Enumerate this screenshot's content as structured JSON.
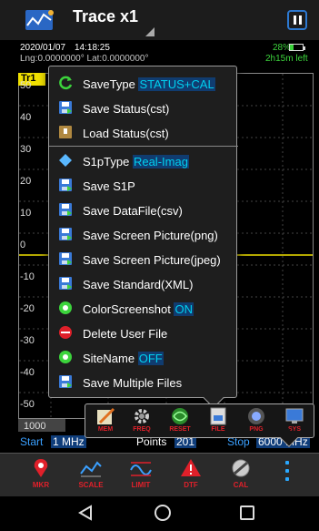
{
  "header": {
    "title": "Trace x1"
  },
  "status": {
    "date": "2020/01/07",
    "time": "14:18:25",
    "coords": "Lng:0.0000000° Lat:0.0000000°",
    "battery_pct": "28%",
    "battery_level": 0.28,
    "time_left": "2h15m left"
  },
  "chart": {
    "trace_label": "Tr1",
    "y_ticks": [
      "50",
      "40",
      "30",
      "20",
      "10",
      "0",
      "-10",
      "-20",
      "-30",
      "-40",
      "-50"
    ],
    "freq_label": "1000"
  },
  "sweep": {
    "start_label": "Start",
    "start_value": "1 MHz",
    "points_label": "Points",
    "points_value": "201",
    "stop_label": "Stop",
    "stop_value": "6000 MHz"
  },
  "menu": {
    "items": [
      {
        "label": "SaveType",
        "value": "STATUS+CAL",
        "icon": "refresh-icon"
      },
      {
        "label": "Save Status(cst)",
        "icon": "save-icon"
      },
      {
        "label": "Load Status(cst)",
        "icon": "load-icon"
      },
      {
        "label": "S1pType",
        "value": "Real-Imag",
        "icon": "diamond-icon"
      },
      {
        "label": "Save S1P",
        "icon": "save-icon"
      },
      {
        "label": "Save DataFile(csv)",
        "icon": "save-icon"
      },
      {
        "label": "Save Screen Picture(png)",
        "icon": "save-icon"
      },
      {
        "label": "Save Screen Picture(jpeg)",
        "icon": "save-icon"
      },
      {
        "label": "Save Standard(XML)",
        "icon": "save-icon"
      },
      {
        "label": "ColorScreenshot",
        "value": "ON",
        "icon": "radio-on-icon"
      },
      {
        "label": "Delete User File",
        "icon": "delete-icon"
      },
      {
        "label": "SiteName",
        "value": "OFF",
        "icon": "radio-on-icon"
      },
      {
        "label": "Save Multiple Files",
        "icon": "save-icon"
      }
    ]
  },
  "subbar": {
    "items": [
      "MEM",
      "FREQ",
      "RESET",
      "FILE",
      "PNG",
      "SYS"
    ]
  },
  "toolbar": {
    "items": [
      "MKR",
      "SCALE",
      "LIMIT",
      "DTF",
      "CAL"
    ]
  },
  "colors": {
    "accent": "#00d0f0",
    "toolbar_label": "#e0202a",
    "trace": "#f0e000"
  }
}
